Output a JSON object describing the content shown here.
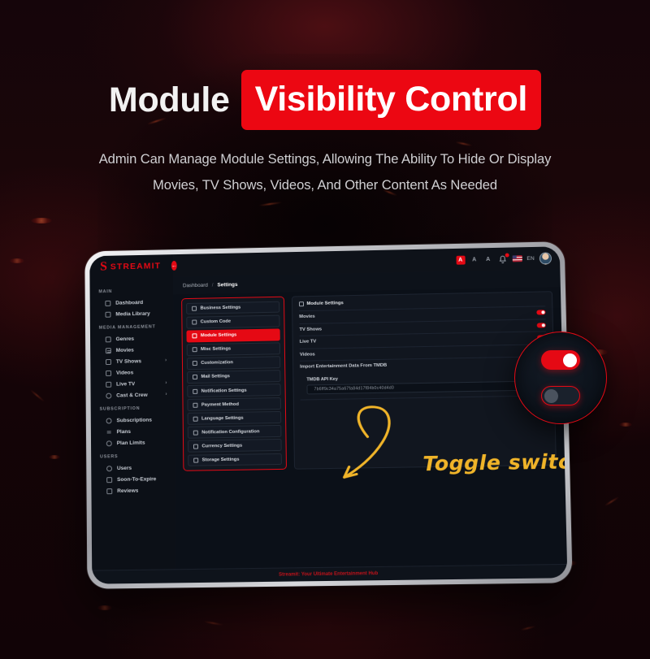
{
  "headline": {
    "plain": "Module",
    "accent": "Visibility Control",
    "accent_color": "#ec0712"
  },
  "subtitle": {
    "line1": "Admin Can Manage Module Settings, Allowing The Ability To Hide Or Display",
    "line2": "Movies, TV Shows, Videos, And Other Content As Needed"
  },
  "app": {
    "brand": {
      "mark": "S",
      "name": "STREAMIT",
      "color": "#e50914"
    },
    "collapse_icon": "arrow-left-icon",
    "topbar": {
      "font_sizes": [
        "A",
        "A",
        "A"
      ],
      "active_font_size_index": 0,
      "bell_icon": "bell-icon",
      "language_code": "EN",
      "flag": "us-flag-icon",
      "avatar": "user-avatar"
    },
    "breadcrumb": {
      "root": "Dashboard",
      "separator": "/",
      "current": "Settings"
    },
    "sidebar": [
      {
        "section": "MAIN",
        "items": [
          {
            "label": "Dashboard",
            "icon": "dashboard-icon",
            "arrow": false
          },
          {
            "label": "Media Library",
            "icon": "media-library-icon",
            "arrow": false
          }
        ]
      },
      {
        "section": "MEDIA MANAGEMENT",
        "items": [
          {
            "label": "Genres",
            "icon": "genres-icon",
            "arrow": false
          },
          {
            "label": "Movies",
            "icon": "movies-icon",
            "arrow": false
          },
          {
            "label": "TV Shows",
            "icon": "tv-shows-icon",
            "arrow": true
          },
          {
            "label": "Videos",
            "icon": "videos-icon",
            "arrow": false
          },
          {
            "label": "Live TV",
            "icon": "live-tv-icon",
            "arrow": true
          },
          {
            "label": "Cast & Crew",
            "icon": "cast-crew-icon",
            "arrow": true
          }
        ]
      },
      {
        "section": "SUBSCRIPTION",
        "items": [
          {
            "label": "Subscriptions",
            "icon": "subscriptions-icon",
            "arrow": false
          },
          {
            "label": "Plans",
            "icon": "plans-icon",
            "arrow": false
          },
          {
            "label": "Plan Limits",
            "icon": "plan-limits-icon",
            "arrow": false
          }
        ]
      },
      {
        "section": "USERS",
        "items": [
          {
            "label": "Users",
            "icon": "users-icon",
            "arrow": false
          },
          {
            "label": "Soon-To-Expire",
            "icon": "soon-to-expire-icon",
            "arrow": false
          },
          {
            "label": "Reviews",
            "icon": "reviews-icon",
            "arrow": false
          }
        ]
      }
    ],
    "settings_menu": {
      "active": "Module Settings",
      "items": [
        {
          "label": "Business Settings",
          "icon": "business-icon"
        },
        {
          "label": "Custom Code",
          "icon": "code-icon"
        },
        {
          "label": "Module Settings",
          "icon": "module-icon"
        },
        {
          "label": "Misc Settings",
          "icon": "misc-icon"
        },
        {
          "label": "Customization",
          "icon": "customization-icon"
        },
        {
          "label": "Mail Settings",
          "icon": "mail-icon"
        },
        {
          "label": "Notification Settings",
          "icon": "notification-icon"
        },
        {
          "label": "Payment Method",
          "icon": "payment-icon"
        },
        {
          "label": "Language Settings",
          "icon": "language-icon"
        },
        {
          "label": "Notification Configuration",
          "icon": "notification-config-icon"
        },
        {
          "label": "Currency Settings",
          "icon": "currency-icon"
        },
        {
          "label": "Storage Settings",
          "icon": "storage-icon"
        }
      ]
    },
    "module_panel": {
      "title": "Module Settings",
      "title_icon": "module-icon",
      "rows": [
        {
          "label": "Movies",
          "toggle": true,
          "state": "on"
        },
        {
          "label": "TV Shows",
          "toggle": true,
          "state": "on"
        },
        {
          "label": "Live TV",
          "toggle": true,
          "state": "on"
        },
        {
          "label": "Videos",
          "toggle": false,
          "state": ""
        },
        {
          "label": "Import Entertainment Data From TMDB",
          "toggle": false,
          "state": ""
        }
      ],
      "tmdb": {
        "label": "TMDB API Key",
        "value": "7b6ff9c34a75a67fa84d17f84b0c40d4d0"
      }
    },
    "annotation": {
      "text": "Toggle switch",
      "color": "#f0b429",
      "arrow": "curved-arrow-icon"
    },
    "footer": "Streamit: Your Ultimate Entertainment Hub",
    "magnifier": {
      "toggle_on_state": "on",
      "toggle_off_state": "off",
      "accent_color": "#e50914"
    }
  }
}
